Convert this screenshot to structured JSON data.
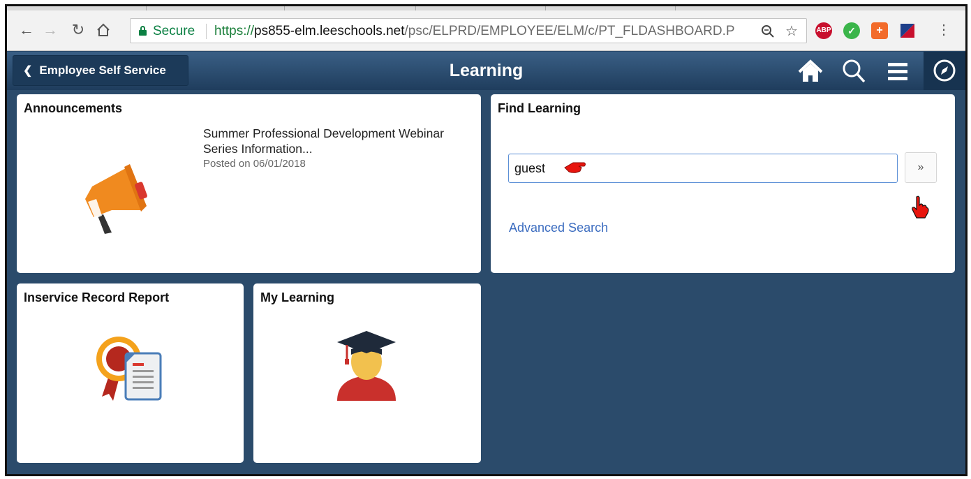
{
  "browser": {
    "secure_label": "Secure",
    "url_scheme": "https://",
    "url_host": "ps855-elm.leeschools.net",
    "url_path": "/psc/ELPRD/EMPLOYEE/ELM/c/PT_FLDASHBOARD.P",
    "ext_abp_label": "ABP",
    "back_icon": "back-arrow-icon",
    "forward_icon": "forward-arrow-icon",
    "reload_icon": "reload-icon",
    "home_icon": "home-icon"
  },
  "header": {
    "back_label": "Employee Self Service",
    "title": "Learning",
    "bg_color": "#2b4b6b"
  },
  "tiles": {
    "announcements": {
      "title": "Announcements",
      "item_title": "Summer Professional Development Webinar Series Information...",
      "item_date": "Posted on 06/01/2018"
    },
    "find_learning": {
      "title": "Find Learning",
      "search_value": "guest",
      "go_label": "»",
      "advanced_search_label": "Advanced Search"
    },
    "inservice": {
      "title": "Inservice Record Report"
    },
    "my_learning": {
      "title": "My Learning"
    }
  },
  "colors": {
    "accent_orange": "#f08a1f",
    "link_blue": "#3a6bbf",
    "pointer_red": "#e8150e"
  }
}
